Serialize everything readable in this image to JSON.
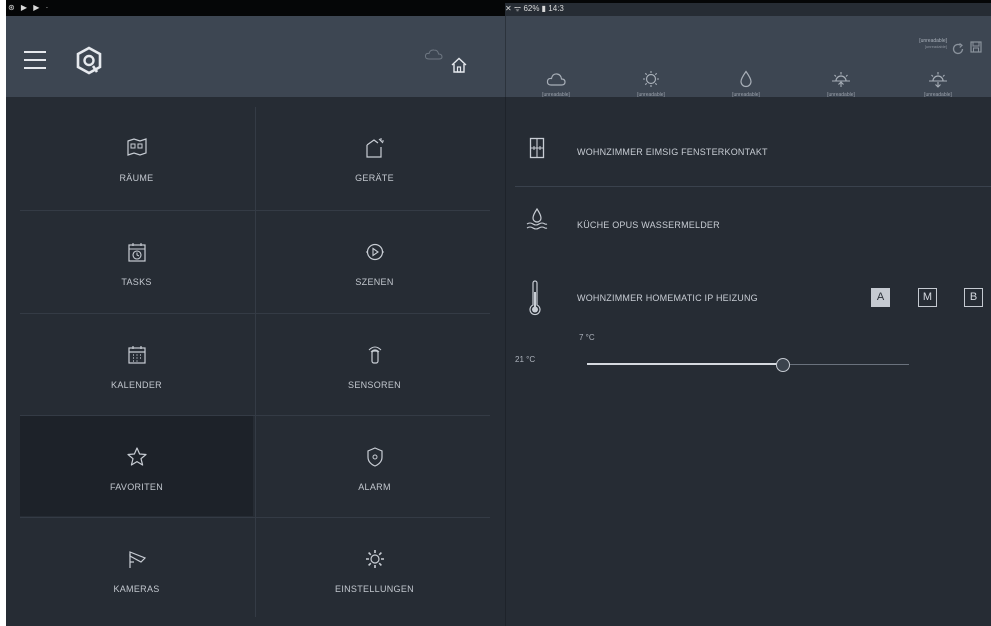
{
  "status_bar": {
    "left_icons": "⊛ ▶ ▶ ·",
    "right_text": "✕ ᯤ 62% ▮ 14:3"
  },
  "header": {
    "weather_location": "[unreadable]",
    "weather_source": "[unreadable]",
    "weather": [
      {
        "icon": "cloud-icon",
        "value": "[unreadable]"
      },
      {
        "icon": "sun-icon",
        "value": "[unreadable]"
      },
      {
        "icon": "drop-icon",
        "value": "[unreadable]"
      },
      {
        "icon": "sunrise-icon",
        "value": "[unreadable]"
      },
      {
        "icon": "sunset-icon",
        "value": "[unreadable]"
      }
    ]
  },
  "menu": {
    "tiles": [
      {
        "label": "RÄUME",
        "icon": "rooms-icon"
      },
      {
        "label": "GERÄTE",
        "icon": "devices-icon"
      },
      {
        "label": "TASKS",
        "icon": "tasks-icon"
      },
      {
        "label": "SZENEN",
        "icon": "scenes-icon"
      },
      {
        "label": "KALENDER",
        "icon": "calendar-icon"
      },
      {
        "label": "SENSOREN",
        "icon": "sensors-icon"
      },
      {
        "label": "FAVORITEN",
        "icon": "star-icon"
      },
      {
        "label": "ALARM",
        "icon": "shield-icon"
      },
      {
        "label": "KAMERAS",
        "icon": "camera-icon"
      },
      {
        "label": "EINSTELLUNGEN",
        "icon": "gear-icon"
      }
    ],
    "active": "FAVORITEN"
  },
  "devices": {
    "window_contact": {
      "title": "WOHNZIMMER EIMSIG FENSTERKONTAKT",
      "icon": "window-icon"
    },
    "water_detector": {
      "title": "KÜCHE OPUS WASSERMELDER",
      "icon": "water-icon"
    },
    "heating": {
      "title": "WOHNZIMMER HOMEMATIC IP HEIZUNG",
      "icon": "thermometer-icon",
      "modes": [
        "A",
        "M",
        "B"
      ],
      "active_mode": "A",
      "current_temp": "7 °C",
      "target_temp": "21 °C",
      "slider_fraction": 0.61
    }
  },
  "colors": {
    "background": "#262c34",
    "header": "#3d4652",
    "active_tile": "#1d2229",
    "text": "#c9ced6"
  }
}
